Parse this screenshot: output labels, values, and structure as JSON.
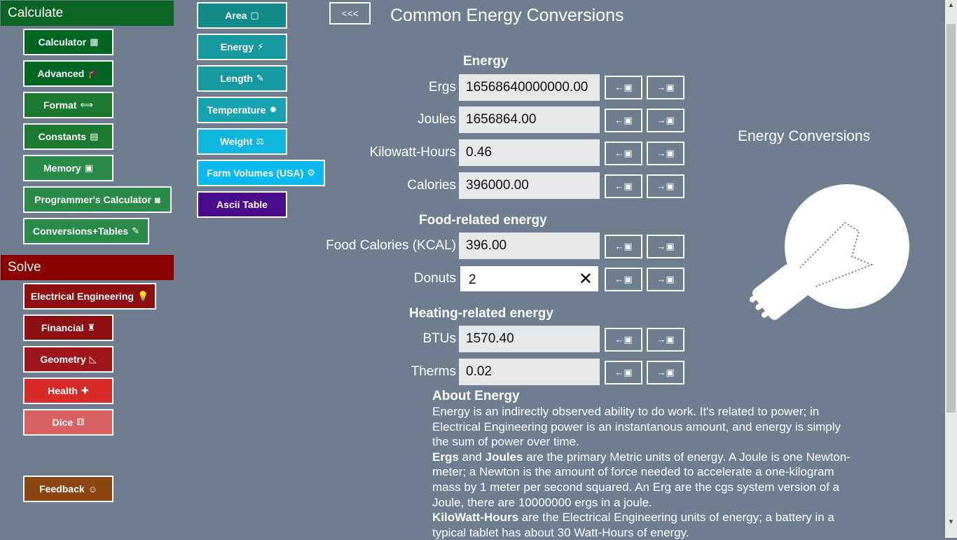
{
  "nav": {
    "calculate_header": "Calculate",
    "calculate": [
      {
        "label": "Calculator",
        "icon": "▦"
      },
      {
        "label": "Advanced",
        "icon": "🎓"
      },
      {
        "label": "Format",
        "icon": "⟺"
      },
      {
        "label": "Constants",
        "icon": "▤"
      },
      {
        "label": "Memory",
        "icon": "▣"
      },
      {
        "label": "Programmer's Calculator",
        "icon": "◙"
      },
      {
        "label": "Conversions+Tables",
        "icon": "✎"
      }
    ],
    "solve_header": "Solve",
    "solve": [
      {
        "label": "Electrical Engineering",
        "icon": "💡"
      },
      {
        "label": "Financial",
        "icon": "♜"
      },
      {
        "label": "Geometry",
        "icon": "◺"
      },
      {
        "label": "Health",
        "icon": "✚"
      },
      {
        "label": "Dice",
        "icon": "⚅"
      }
    ],
    "feedback": {
      "label": "Feedback",
      "icon": "☺"
    }
  },
  "conversions": [
    {
      "label": "Area",
      "icon": "▢"
    },
    {
      "label": "Energy",
      "icon": "⚡"
    },
    {
      "label": "Length",
      "icon": "✎"
    },
    {
      "label": "Temperature",
      "icon": "✹"
    },
    {
      "label": "Weight",
      "icon": "⚖"
    },
    {
      "label": "Farm Volumes (USA)",
      "icon": "⚙"
    },
    {
      "label": "Ascii Table",
      "icon": ""
    }
  ],
  "page": {
    "back": "<<<",
    "title": "Common Energy Conversions"
  },
  "sections": {
    "energy": "Energy",
    "food": "Food-related energy",
    "heating": "Heating-related energy"
  },
  "rows": [
    {
      "label": "Ergs",
      "value": "16568640000000.00"
    },
    {
      "label": "Joules",
      "value": "1656864.00"
    },
    {
      "label": "Kilowatt-Hours",
      "value": "0.46"
    },
    {
      "label": "Calories",
      "value": "396000.00"
    },
    {
      "label": "Food Calories (KCAL)",
      "value": "396.00"
    },
    {
      "label": "Donuts",
      "value": "2"
    },
    {
      "label": "BTUs",
      "value": "1570.40"
    },
    {
      "label": "Therms",
      "value": "0.02"
    }
  ],
  "row_buttons": {
    "copy_from": "←▣",
    "copy_to": "→▣"
  },
  "clear_glyph": "✕",
  "panel_title": "Energy Conversions",
  "about": {
    "heading": "About Energy",
    "p1": "Energy is an indirectly observed ability to do work. It's related to power; in Electrical Engineering power is an instantanous amount, and energy is simply the sum of power over time.",
    "p2_b1": "Ergs",
    "p2_t1": " and ",
    "p2_b2": "Joules",
    "p2_t2": " are the primary Metric units of energy. A Joule is one Newton-meter; a Newton is the amount of force needed to accelerate a one-kilogram mass by 1 meter per second squared. An Erg are the cgs system version of a Joule, there are 10000000 ergs in a joule.",
    "p3_b1": "KiloWatt-Hours",
    "p3_t1": " are the Electrical Engineering units of energy; a battery in a typical tablet has about 30 Watt-Hours of energy."
  },
  "scrollbar": {
    "up": "▲",
    "down": "▼"
  }
}
